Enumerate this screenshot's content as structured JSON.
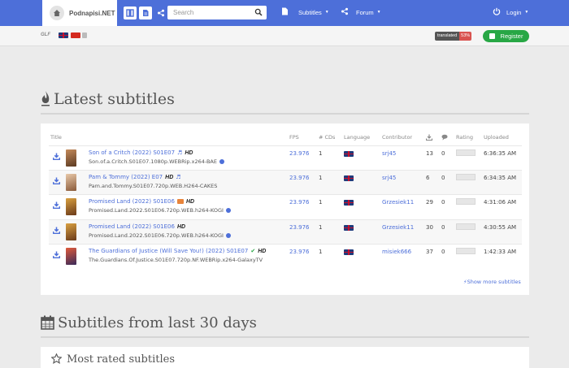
{
  "brand": {
    "name": "Podnapisi.NET"
  },
  "search": {
    "placeholder": "Search"
  },
  "nav": {
    "subtitles": "Subtitles",
    "forum": "Forum",
    "login": "Login"
  },
  "subbar": {
    "glf": "GLF",
    "translated_label": "translated",
    "translated_pct": "53%",
    "register": "Register"
  },
  "latest": {
    "heading": "Latest subtitles",
    "columns": [
      "Title",
      "FPS",
      "# CDs",
      "Language",
      "Contributor",
      "Rating",
      "Uploaded"
    ],
    "rows": [
      {
        "title": "Son of a Critch (2022) S01E07",
        "release": "Son.of.a.Critch.S01E07.1080p.WEBRip.x264-BAE",
        "fps": "23.976",
        "cds": "1",
        "contributor": "srj45",
        "downloads": "13",
        "comments": "0",
        "uploaded": "6:36:35 AM"
      },
      {
        "title": "Pam & Tommy (2022) E07",
        "release": "Pam.and.Tommy.S01E07.720p.WEB.H264-CAKES",
        "fps": "23.976",
        "cds": "1",
        "contributor": "srj45",
        "downloads": "6",
        "comments": "0",
        "uploaded": "6:34:35 AM"
      },
      {
        "title": "Promised Land (2022) S01E06",
        "release": "Promised.Land.2022.S01E06.720p.WEB.h264-KOGI",
        "fps": "23.976",
        "cds": "1",
        "contributor": "Grzesiek11",
        "downloads": "29",
        "comments": "0",
        "uploaded": "4:31:06 AM"
      },
      {
        "title": "Promised Land (2022) S01E06",
        "release": "Promised.Land.2022.S01E06.720p.WEB.h264-KOGI",
        "fps": "23.976",
        "cds": "1",
        "contributor": "Grzesiek11",
        "downloads": "30",
        "comments": "0",
        "uploaded": "4:30:55 AM"
      },
      {
        "title": "The Guardians of Justice (Will Save You!) (2022) S01E07",
        "release": "The.Guardians.Of.Justice.S01E07.720p.NF.WEBRip.x264-GalaxyTV",
        "fps": "23.976",
        "cds": "1",
        "contributor": "misiek666",
        "downloads": "37",
        "comments": "0",
        "uploaded": "1:42:33 AM"
      }
    ],
    "hd_label": "HD",
    "more": "Show more subtitles"
  },
  "last30": {
    "heading": "Subtitles from last 30 days"
  },
  "most_rated": {
    "heading": "Most rated subtitles"
  },
  "colors": {
    "accent": "#4d6fd9",
    "register": "#28a745",
    "badge": "#d9534f"
  }
}
